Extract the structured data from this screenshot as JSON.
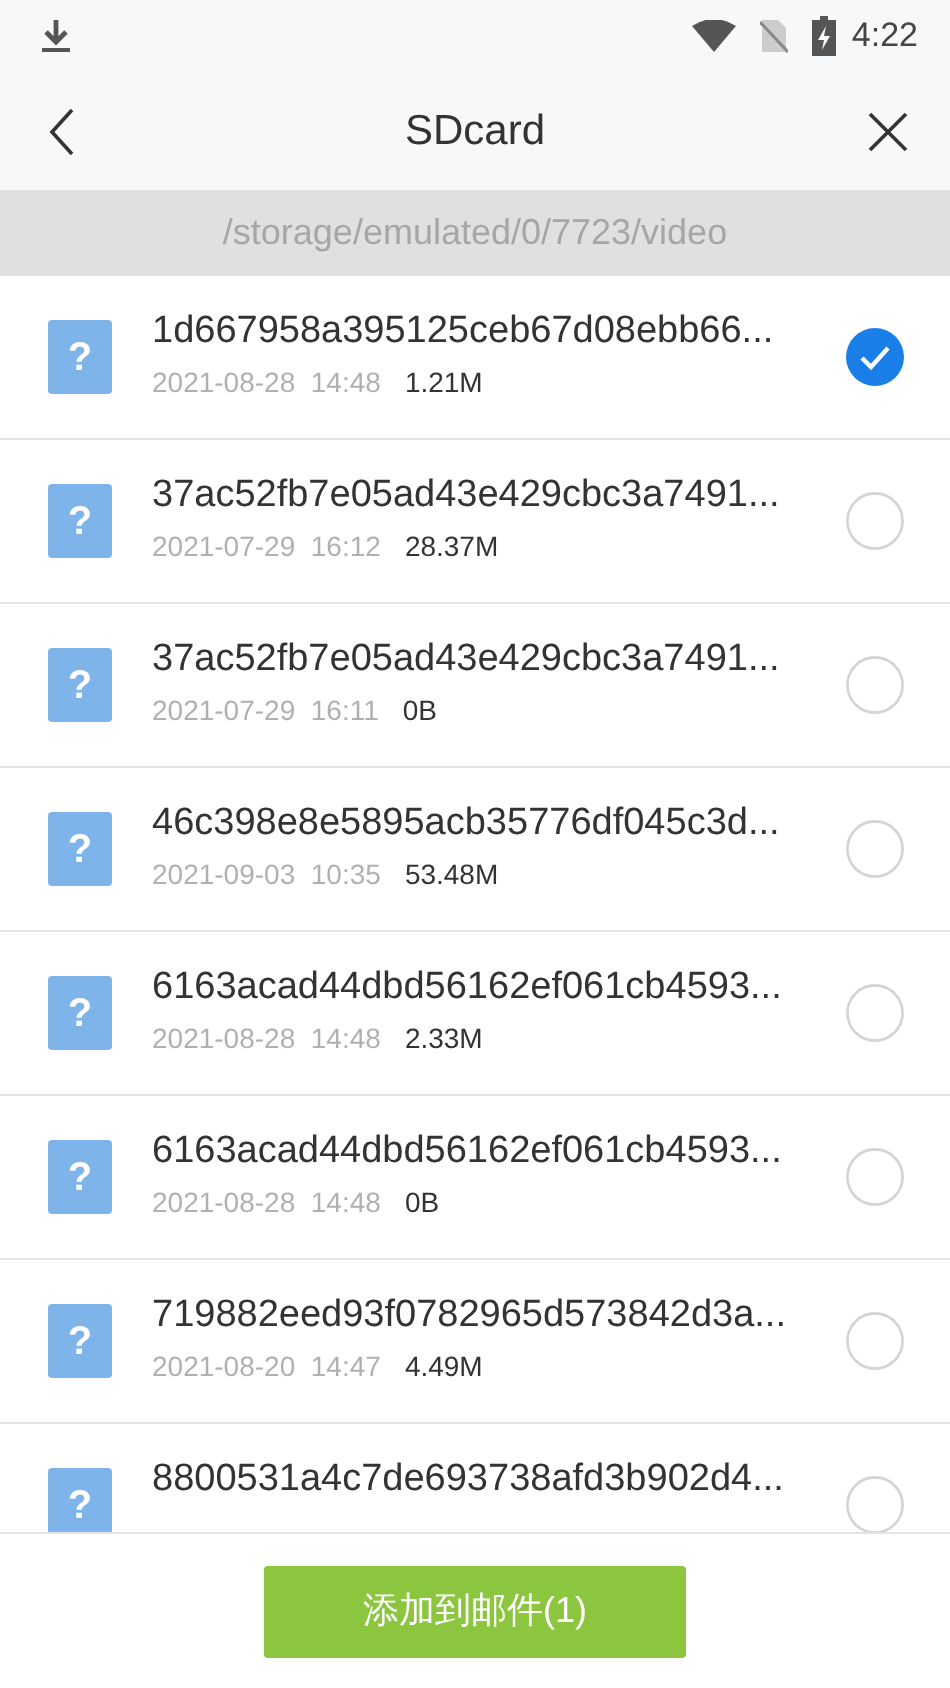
{
  "status_bar": {
    "time": "4:22"
  },
  "header": {
    "title": "SDcard"
  },
  "path": "/storage/emulated/0/7723/video",
  "files": [
    {
      "icon": "?",
      "name": "1d667958a395125ceb67d08ebb66...",
      "date": "2021-08-28  14:48",
      "size": "1.21M",
      "selected": true
    },
    {
      "icon": "?",
      "name": "37ac52fb7e05ad43e429cbc3a7491...",
      "date": "2021-07-29  16:12",
      "size": "28.37M",
      "selected": false
    },
    {
      "icon": "?",
      "name": "37ac52fb7e05ad43e429cbc3a7491...",
      "date": "2021-07-29  16:11",
      "size": "0B",
      "selected": false
    },
    {
      "icon": "?",
      "name": "46c398e8e5895acb35776df045c3d...",
      "date": "2021-09-03  10:35",
      "size": "53.48M",
      "selected": false
    },
    {
      "icon": "?",
      "name": "6163acad44dbd56162ef061cb4593...",
      "date": "2021-08-28  14:48",
      "size": "2.33M",
      "selected": false
    },
    {
      "icon": "?",
      "name": "6163acad44dbd56162ef061cb4593...",
      "date": "2021-08-28  14:48",
      "size": "0B",
      "selected": false
    },
    {
      "icon": "?",
      "name": "719882eed93f0782965d573842d3a...",
      "date": "2021-08-20  14:47",
      "size": "4.49M",
      "selected": false
    },
    {
      "icon": "?",
      "name": "8800531a4c7de693738afd3b902d4...",
      "selected": false
    }
  ],
  "action_button": "添加到邮件(1)"
}
